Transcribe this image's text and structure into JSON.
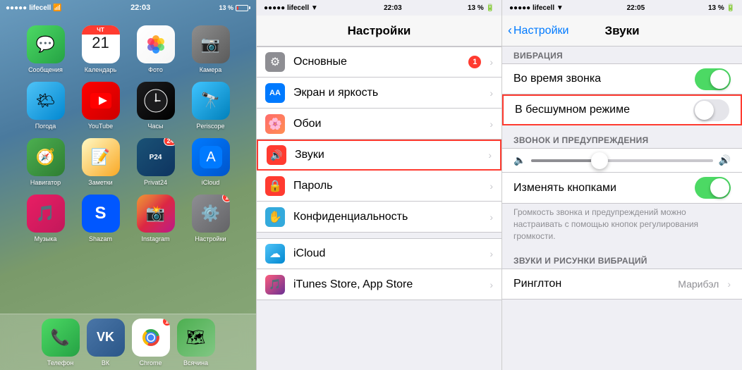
{
  "phone1": {
    "status": {
      "carrier": "lifecell",
      "time": "22:03",
      "battery_pct": "13 %"
    },
    "apps": [
      {
        "id": "messages",
        "label": "Сообщения",
        "color_class": "app-messages"
      },
      {
        "id": "calendar",
        "label": "Календарь",
        "color_class": "app-calendar",
        "special": "calendar",
        "day": "21",
        "month": "ЧТ"
      },
      {
        "id": "photos",
        "label": "Фото",
        "color_class": "app-photos"
      },
      {
        "id": "camera",
        "label": "Камера",
        "color_class": "app-camera"
      },
      {
        "id": "weather",
        "label": "Погода",
        "color_class": "app-weather"
      },
      {
        "id": "youtube",
        "label": "YouTube",
        "color_class": "app-youtube"
      },
      {
        "id": "clock",
        "label": "Часы",
        "color_class": "app-clock"
      },
      {
        "id": "periscope",
        "label": "Periscope",
        "color_class": "app-periscope"
      },
      {
        "id": "maps",
        "label": "Навигатор",
        "color_class": "app-maps"
      },
      {
        "id": "notes",
        "label": "Заметки",
        "color_class": "app-notes"
      },
      {
        "id": "privat24",
        "label": "Privat24",
        "color_class": "app-privat24",
        "badge_text": "24"
      },
      {
        "id": "appstore",
        "label": "App Store",
        "color_class": "app-appstore"
      },
      {
        "id": "music",
        "label": "Музыка",
        "color_class": "app-music"
      },
      {
        "id": "shazam",
        "label": "Shazam",
        "color_class": "app-shazam"
      },
      {
        "id": "instagram",
        "label": "Instagram",
        "color_class": "app-instagram"
      },
      {
        "id": "settings",
        "label": "Настройки",
        "color_class": "app-settings",
        "badge": true,
        "badge_text": "1"
      }
    ],
    "dock": [
      {
        "id": "phone",
        "label": "Телефон",
        "color_class": "app-phone"
      },
      {
        "id": "vk",
        "label": "ВК",
        "color_class": "app-vk"
      },
      {
        "id": "chrome",
        "label": "Chrome",
        "color_class": "app-chrome"
      },
      {
        "id": "maps2",
        "label": "Всячина",
        "color_class": "app-maps2",
        "badge": true,
        "badge_text": "1"
      }
    ]
  },
  "phone2": {
    "status": {
      "carrier": "lifecell",
      "time": "22:03",
      "battery_pct": "13 %"
    },
    "nav_title": "Настройки",
    "items": [
      {
        "id": "general",
        "label": "Основные",
        "icon_class": "icon-general",
        "icon": "⚙",
        "badge": true,
        "badge_text": "1"
      },
      {
        "id": "display",
        "label": "Экран и яркость",
        "icon_class": "icon-display",
        "icon": "AA"
      },
      {
        "id": "wallpaper",
        "label": "Обои",
        "icon_class": "icon-wallpaper",
        "icon": "🌸"
      },
      {
        "id": "sounds",
        "label": "Звуки",
        "icon_class": "icon-sounds",
        "icon": "🔊",
        "highlighted": true
      },
      {
        "id": "passcode",
        "label": "Пароль",
        "icon_class": "icon-passcode",
        "icon": "🔒"
      },
      {
        "id": "privacy",
        "label": "Конфиденциальность",
        "icon_class": "icon-privacy",
        "icon": "✋"
      },
      {
        "id": "icloud",
        "label": "iCloud",
        "icon_class": "icon-icloud",
        "icon": "☁"
      },
      {
        "id": "itunes",
        "label": "iTunes Store, App Store",
        "icon_class": "icon-itunes",
        "icon": "🎵"
      }
    ]
  },
  "phone3": {
    "status": {
      "carrier": "lifecell",
      "time": "22:05",
      "battery_pct": "13 %"
    },
    "back_label": "Настройки",
    "nav_title": "Звуки",
    "section_vibration": "ВИБРАЦИЯ",
    "row_during_call": "Во время звонка",
    "row_silent_mode": "В бесшумном режиме",
    "section_ringtone": "ЗВОНОК И ПРЕДУПРЕЖДЕНИЯ",
    "row_change_with_buttons": "Изменять кнопками",
    "hint_text": "Громкость звонка и предупреждений можно настраивать с помощью кнопок регулирования громкости.",
    "section_sounds_vibration": "ЗВУКИ И РИСУНКИ ВИБРАЦИЙ",
    "row_ringtone": "Ринглтон"
  }
}
